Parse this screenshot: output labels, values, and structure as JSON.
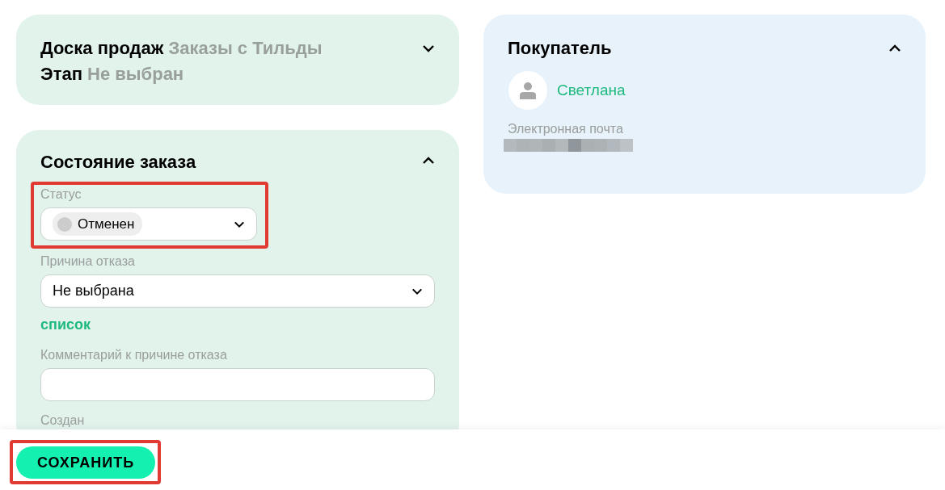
{
  "deal_card": {
    "expanded": false,
    "lines": [
      {
        "label": "Доска продаж",
        "value": "Заказы с Тильды"
      },
      {
        "label": "Этап",
        "value": "Не выбран"
      }
    ]
  },
  "order_card": {
    "title": "Состояние заказа",
    "expanded": true,
    "status": {
      "label": "Статус",
      "value": "Отменен",
      "color": "#cccccc",
      "highlighted": true
    },
    "reason": {
      "label": "Причина отказа",
      "value": "Не выбрана"
    },
    "list_link": "список",
    "comment": {
      "label": "Комментарий к причине отказа"
    },
    "created_label": "Создан"
  },
  "buyer_card": {
    "title": "Покупатель",
    "expanded": true,
    "name": "Светлана",
    "email_label": "Электронная почта"
  },
  "save_button": {
    "label": "СОХРАНИТЬ",
    "highlighted": true
  }
}
